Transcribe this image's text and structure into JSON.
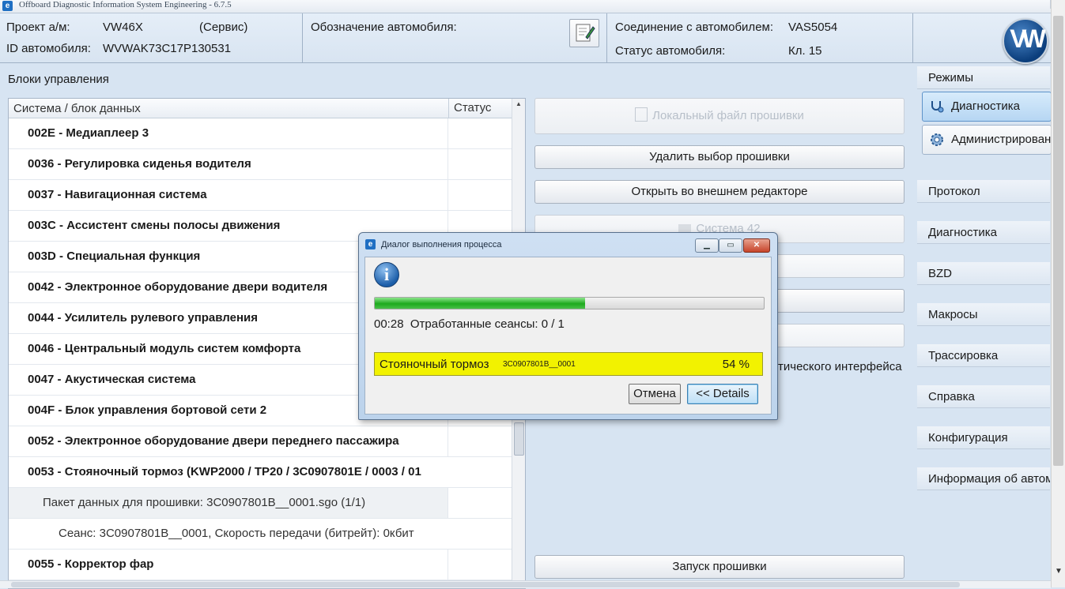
{
  "window": {
    "title": "Offboard Diagnostic Information System Engineering - 6.7.5"
  },
  "header": {
    "project_label": "Проект а/м:",
    "project_value": "VW46X",
    "project_mode": "(Сервис)",
    "vin_label": "ID автомобиля:",
    "vin_value": "WVWAK73C17P130531",
    "designation_label": "Обозначение автомобиля:",
    "connection_label": "Соединение с автомобилем:",
    "connection_value": "VAS5054",
    "status_label": "Статус автомобиля:",
    "status_value": "Кл. 15",
    "logo_text": "VW"
  },
  "tree": {
    "section_title": "Блоки управления",
    "col_system": "Система / блок данных",
    "col_status": "Статус",
    "rows": [
      "002E - Медиаплеер 3",
      "0036 - Регулировка сиденья водителя",
      "0037 - Навигационная система",
      "003C - Ассистент смены полосы движения",
      "003D - Специальная функция",
      "0042 - Электронное оборудование двери водителя",
      "0044 - Усилитель рулевого управления",
      "0046 - Центральный модуль систем комфорта",
      "0047 - Акустическая система",
      "004F - Блок управления бортовой сети 2",
      "0052 - Электронное оборудование двери переднего пассажира",
      "0053 - Стояночный тормоз  (KWP2000 / TP20 / 3C0907801E / 0003 / 01",
      "Пакет данных для прошивки: 3C0907801B__0001.sgo (1/1)",
      "Сеанс: 3C0907801B__0001, Скорость передачи (битрейт): 0кбит",
      "0055 - Корректор фар"
    ]
  },
  "actions": {
    "local_file": "Локальный файл прошивки",
    "delete_selection": "Удалить выбор прошивки",
    "open_editor": "Открыть во внешнем редакторе",
    "system_partial": "Система 42",
    "interface_partial": "тического интерфейса",
    "start_flash": "Запуск прошивки"
  },
  "sidebar": {
    "modes_title": "Режимы",
    "mode_diagnostics": "Диагностика",
    "mode_admin": "Администрирование",
    "sections": [
      "Протокол",
      "Диагностика",
      "BZD",
      "Макросы",
      "Трассировка",
      "Справка",
      "Конфигурация",
      "Информация об автомобиле"
    ]
  },
  "dialog": {
    "title": "Диалог выполнения процесса",
    "progress_percent": 54,
    "time": "00:28",
    "sessions_text": "Отработанные сеансы: 0 / 1",
    "task_name": "Стояночный тормоз",
    "task_file": "3C0907801B__0001",
    "task_percent": "54 %",
    "cancel_label": "Отмена",
    "details_label": "<< Details"
  }
}
